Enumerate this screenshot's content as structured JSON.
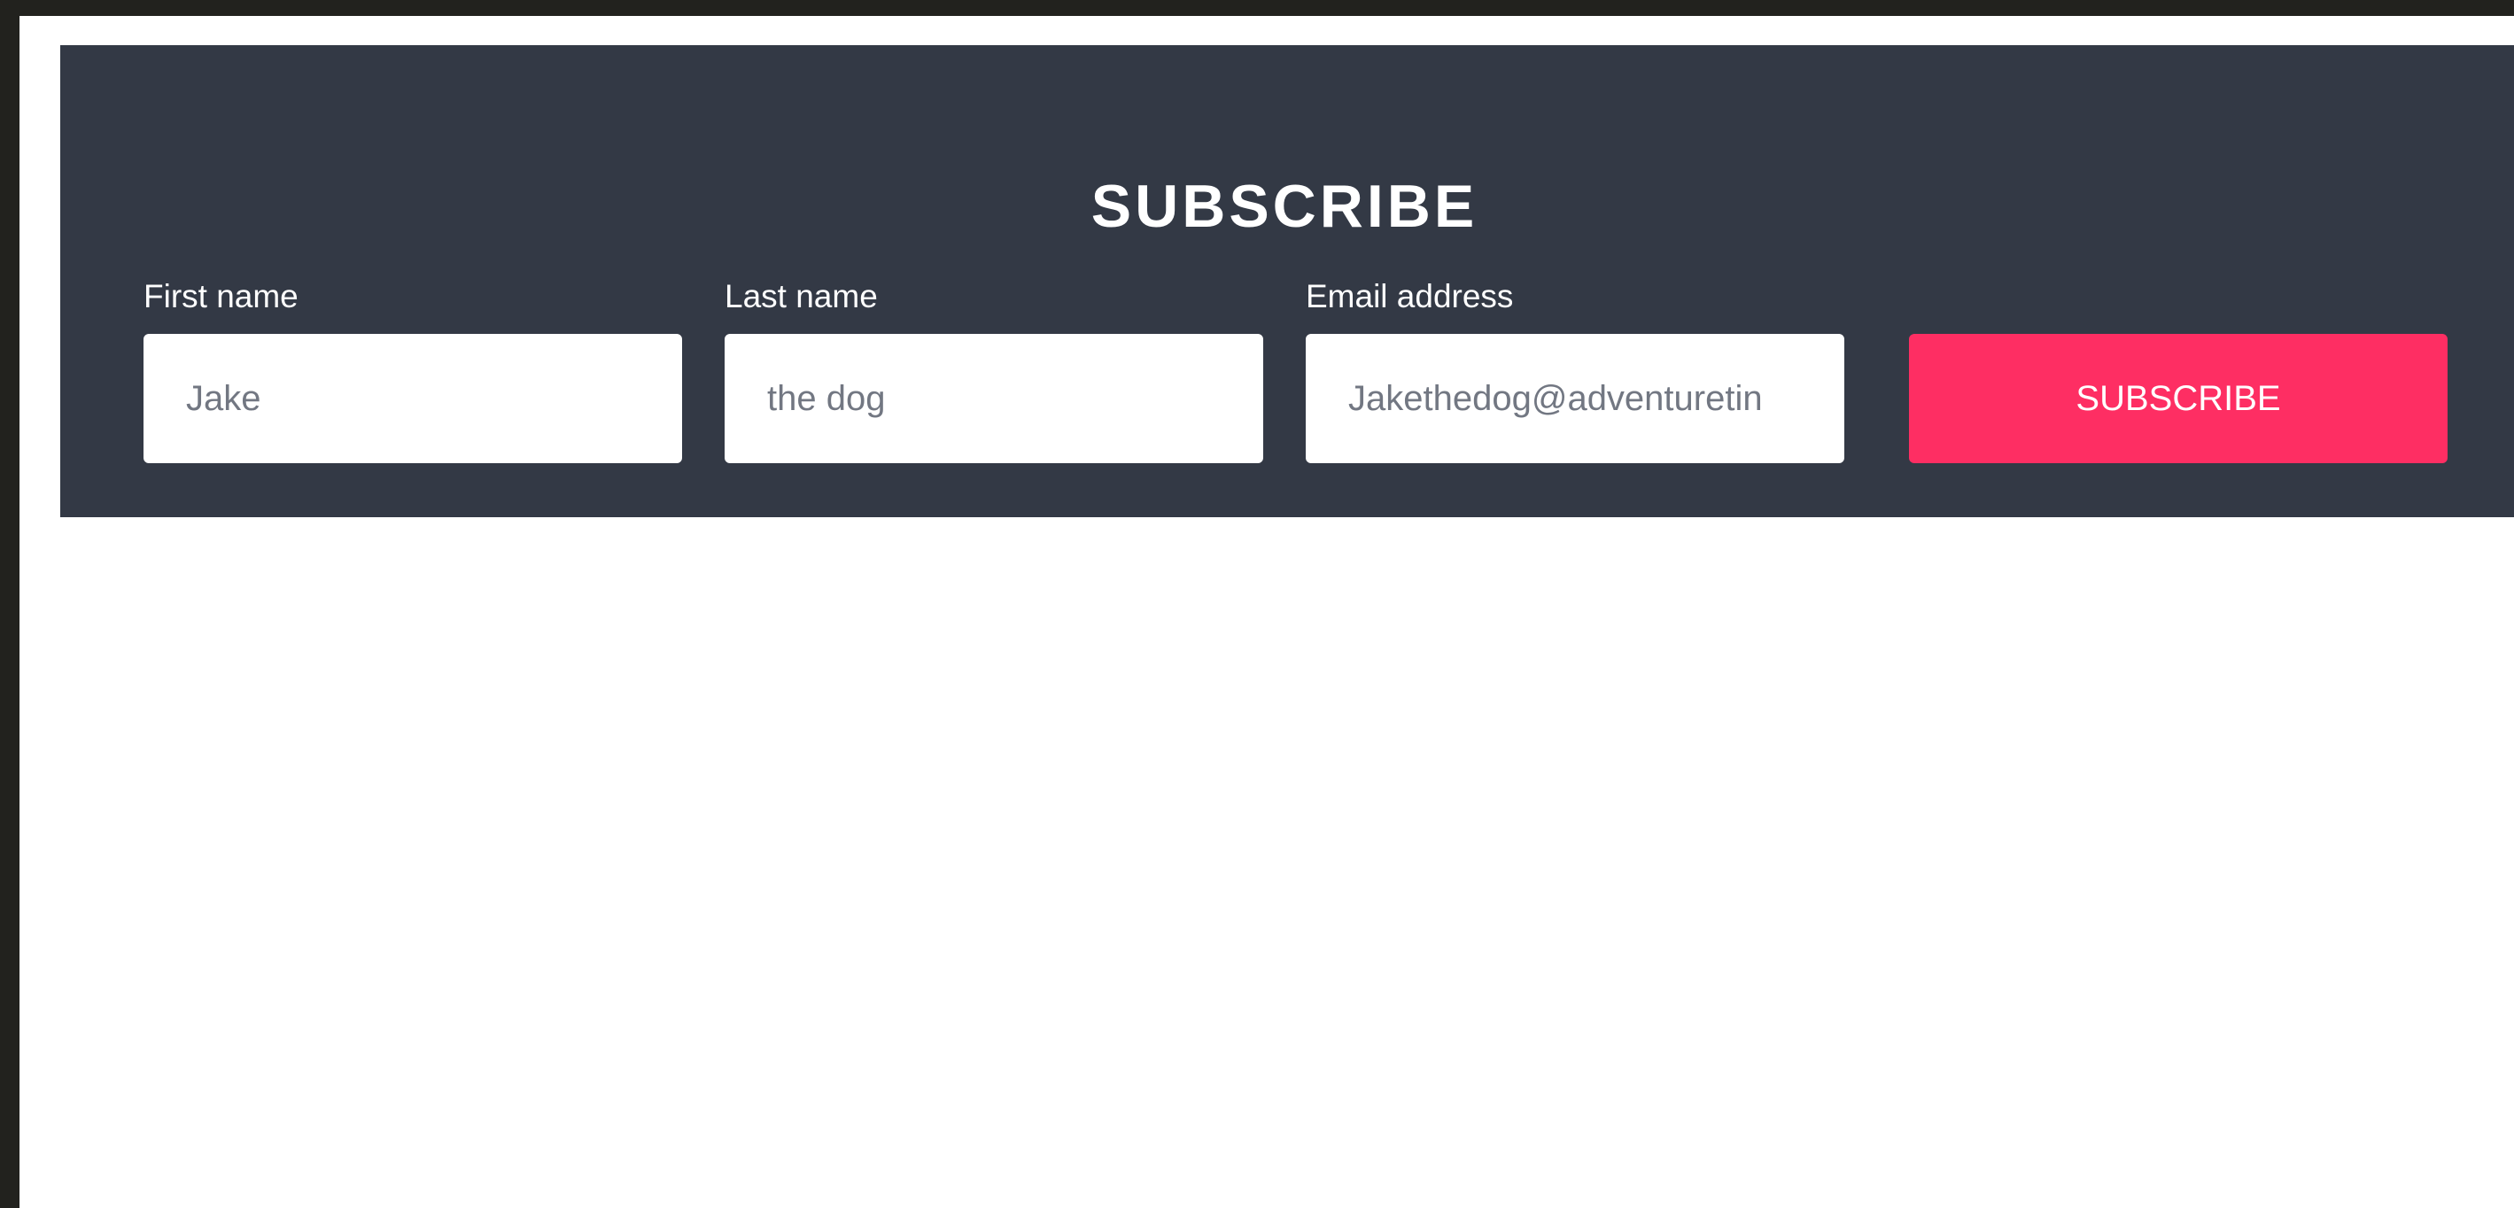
{
  "form": {
    "title": "SUBSCRIBE",
    "fields": [
      {
        "label": "First name",
        "value": "Jake"
      },
      {
        "label": "Last name",
        "value": "the dog"
      },
      {
        "label": "Email address",
        "value": "Jakethedog@adventuretin"
      }
    ],
    "submit_label": "SUBSCRIBE"
  },
  "colors": {
    "panel_background": "#333945",
    "button_accent": "#fe2e63",
    "input_text": "#727782",
    "outer_frame": "#22221e"
  }
}
